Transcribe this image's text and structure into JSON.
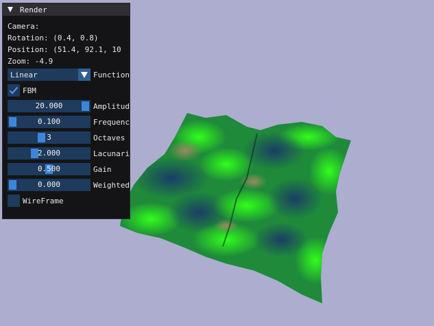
{
  "window": {
    "title": "Render",
    "camera_label": "Camera:",
    "rotation": "Rotation: (0.4, 0.8)",
    "position": "Position: (51.4, 92.1, 10",
    "zoom": "Zoom: -4.9"
  },
  "function_combo": {
    "value": "Linear",
    "label": "Function"
  },
  "fbm": {
    "label": "FBM",
    "checked": true
  },
  "sliders": [
    {
      "value": "20.000",
      "label": "Amplitude",
      "fill": 1.0
    },
    {
      "value": "0.100",
      "label": "Frequency",
      "fill": 0.0
    },
    {
      "value": "3",
      "label": "Octaves",
      "fill": 0.4
    },
    {
      "value": "2.000",
      "label": "Lacunarity",
      "fill": 0.3
    },
    {
      "value": "0.500",
      "label": "Gain",
      "fill": 0.5
    },
    {
      "value": "0.000",
      "label": "Weighted",
      "fill": 0.0
    }
  ],
  "wireframe": {
    "label": "WireFrame",
    "checked": false
  },
  "colors": {
    "background": "#adadcf",
    "panel": "#141416",
    "frame": "#1e3a5c",
    "accent": "#3d85d9"
  }
}
